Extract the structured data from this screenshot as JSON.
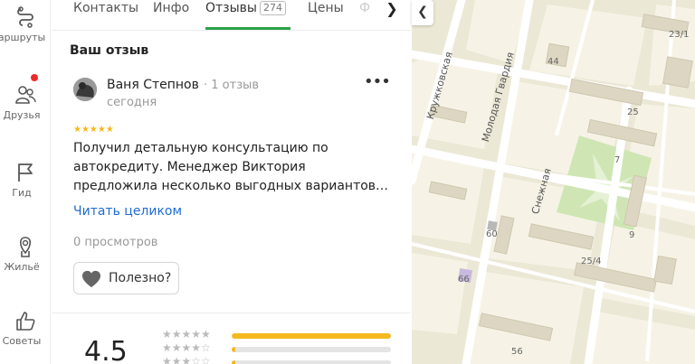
{
  "rail": {
    "items": [
      {
        "label": "аршруты",
        "icon": "routes-icon"
      },
      {
        "label": "Друзья",
        "icon": "friends-icon"
      },
      {
        "label": "Гид",
        "icon": "guide-flag-icon"
      },
      {
        "label": "Жильё",
        "icon": "housing-icon"
      },
      {
        "label": "Советы",
        "icon": "thumbs-up-icon"
      }
    ]
  },
  "tabs": {
    "items": [
      "Контакты",
      "Инфо",
      "Отзывы",
      "Цены"
    ],
    "active": "Отзывы",
    "reviews_count": "274",
    "next_icon": "chevron-right-icon"
  },
  "review": {
    "section_title": "Ваш отзыв",
    "author": "Ваня Степнов",
    "author_reviews": "1 отзыв",
    "date": "сегодня",
    "rating": 5,
    "text": "Получил детальную консультацию по автокредиту. Менеджер Виктория предложила несколько выгодных вариантов…",
    "read_more": "Читать целиком",
    "views": "0 просмотров",
    "useful_label": "Полезно?"
  },
  "summary": {
    "rating": "4.5",
    "distribution": [
      {
        "stars": 5,
        "fraction": 1.0
      },
      {
        "stars": 4,
        "fraction": 0.02
      },
      {
        "stars": 3,
        "fraction": 0.02
      }
    ]
  },
  "map": {
    "streets": [
      "Кружковская",
      "Молодая Гвардия",
      "Снежная"
    ],
    "houses": [
      "44",
      "25",
      "23/1",
      "7",
      "60",
      "9",
      "25/4",
      "66",
      "56"
    ],
    "colors": {
      "accent": "#2ca24a",
      "star": "#f5b820",
      "link": "#1e6bd6",
      "badge": "#ee2a2a"
    }
  }
}
